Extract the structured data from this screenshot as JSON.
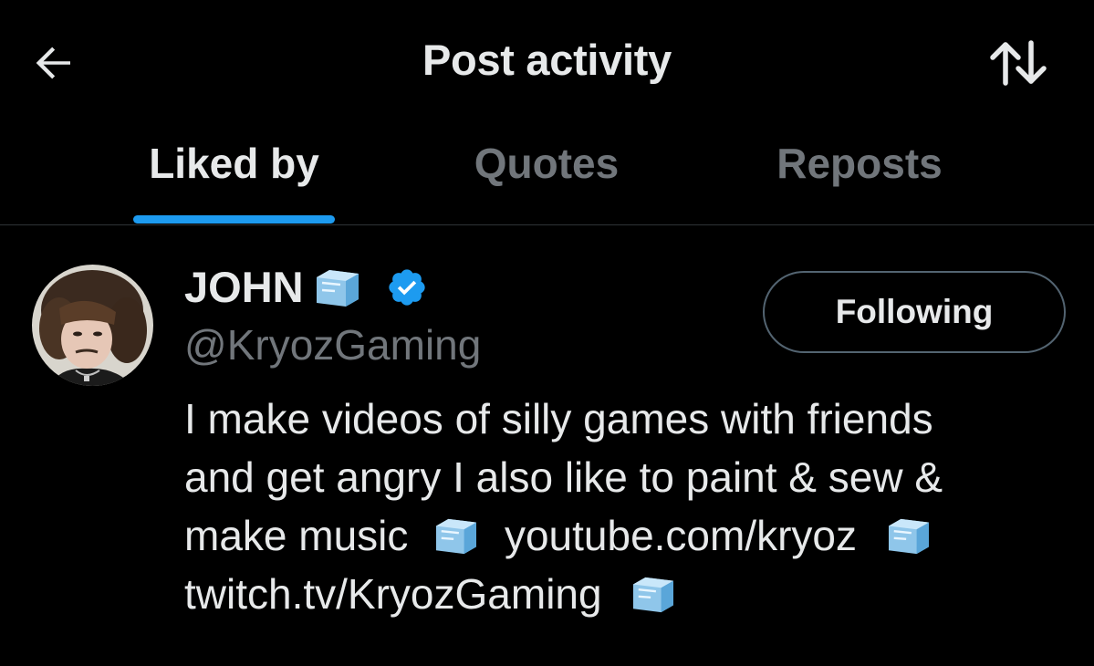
{
  "header": {
    "title": "Post activity",
    "back_icon": "arrow-left-icon",
    "sort_icon": "sort-arrows-icon"
  },
  "tabs": [
    {
      "label": "Liked by",
      "active": true
    },
    {
      "label": "Quotes",
      "active": false
    },
    {
      "label": "Reposts",
      "active": false
    }
  ],
  "user": {
    "name": "JOHN",
    "name_emoji": "ice-cube-icon",
    "verified_icon": "verified-badge-icon",
    "handle": "@KryozGaming",
    "follow_label": "Following",
    "bio": {
      "line1": "I make videos of silly games with friends",
      "line2": "and get angry I also like to paint & sew &",
      "line3_text": "make music",
      "link1": "youtube.com/kryoz",
      "link2": "twitch.tv/KryozGaming"
    }
  },
  "colors": {
    "background": "#000000",
    "text_primary": "#e7e9ea",
    "text_secondary": "#71767b",
    "accent": "#1d9bf0",
    "divider": "#2f3336",
    "button_border": "#536471"
  }
}
